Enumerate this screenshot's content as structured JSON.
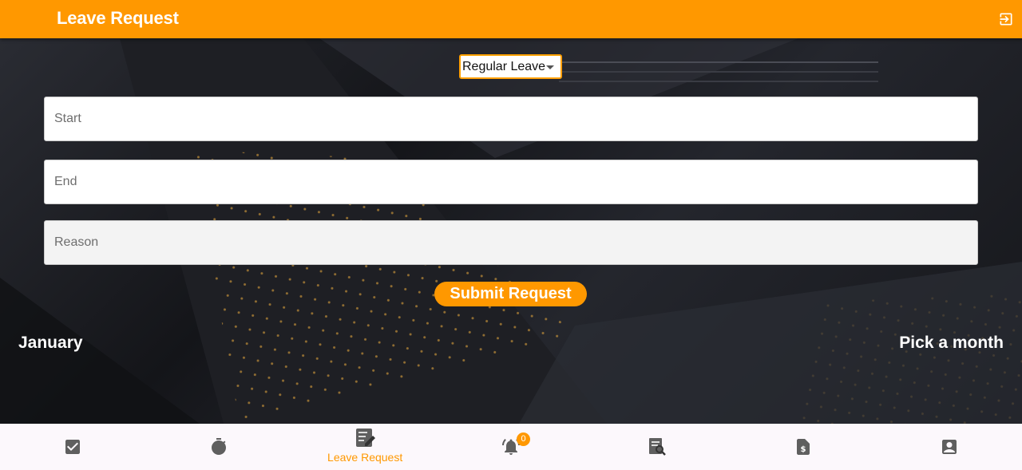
{
  "appbar": {
    "title": "Leave Request",
    "logout_icon": "logout-icon"
  },
  "form": {
    "leave_type": "Regular Leave",
    "start_placeholder": "Start",
    "end_placeholder": "End",
    "reason_placeholder": "Reason",
    "submit_label": "Submit Request"
  },
  "calendar": {
    "month": "January",
    "pick_month_label": "Pick a month"
  },
  "colors": {
    "accent": "#ff9800",
    "nav_background": "#fcf8fc",
    "icon": "#5f5f5f"
  },
  "bottom_nav": {
    "items": [
      {
        "icon": "checkbox-icon",
        "label": ""
      },
      {
        "icon": "stopwatch-icon",
        "label": ""
      },
      {
        "icon": "leave-request-icon",
        "label": "Leave Request",
        "active": true
      },
      {
        "icon": "bell-icon",
        "label": "",
        "badge": "0"
      },
      {
        "icon": "document-search-icon",
        "label": ""
      },
      {
        "icon": "payslip-icon",
        "label": ""
      },
      {
        "icon": "profile-icon",
        "label": ""
      }
    ]
  }
}
